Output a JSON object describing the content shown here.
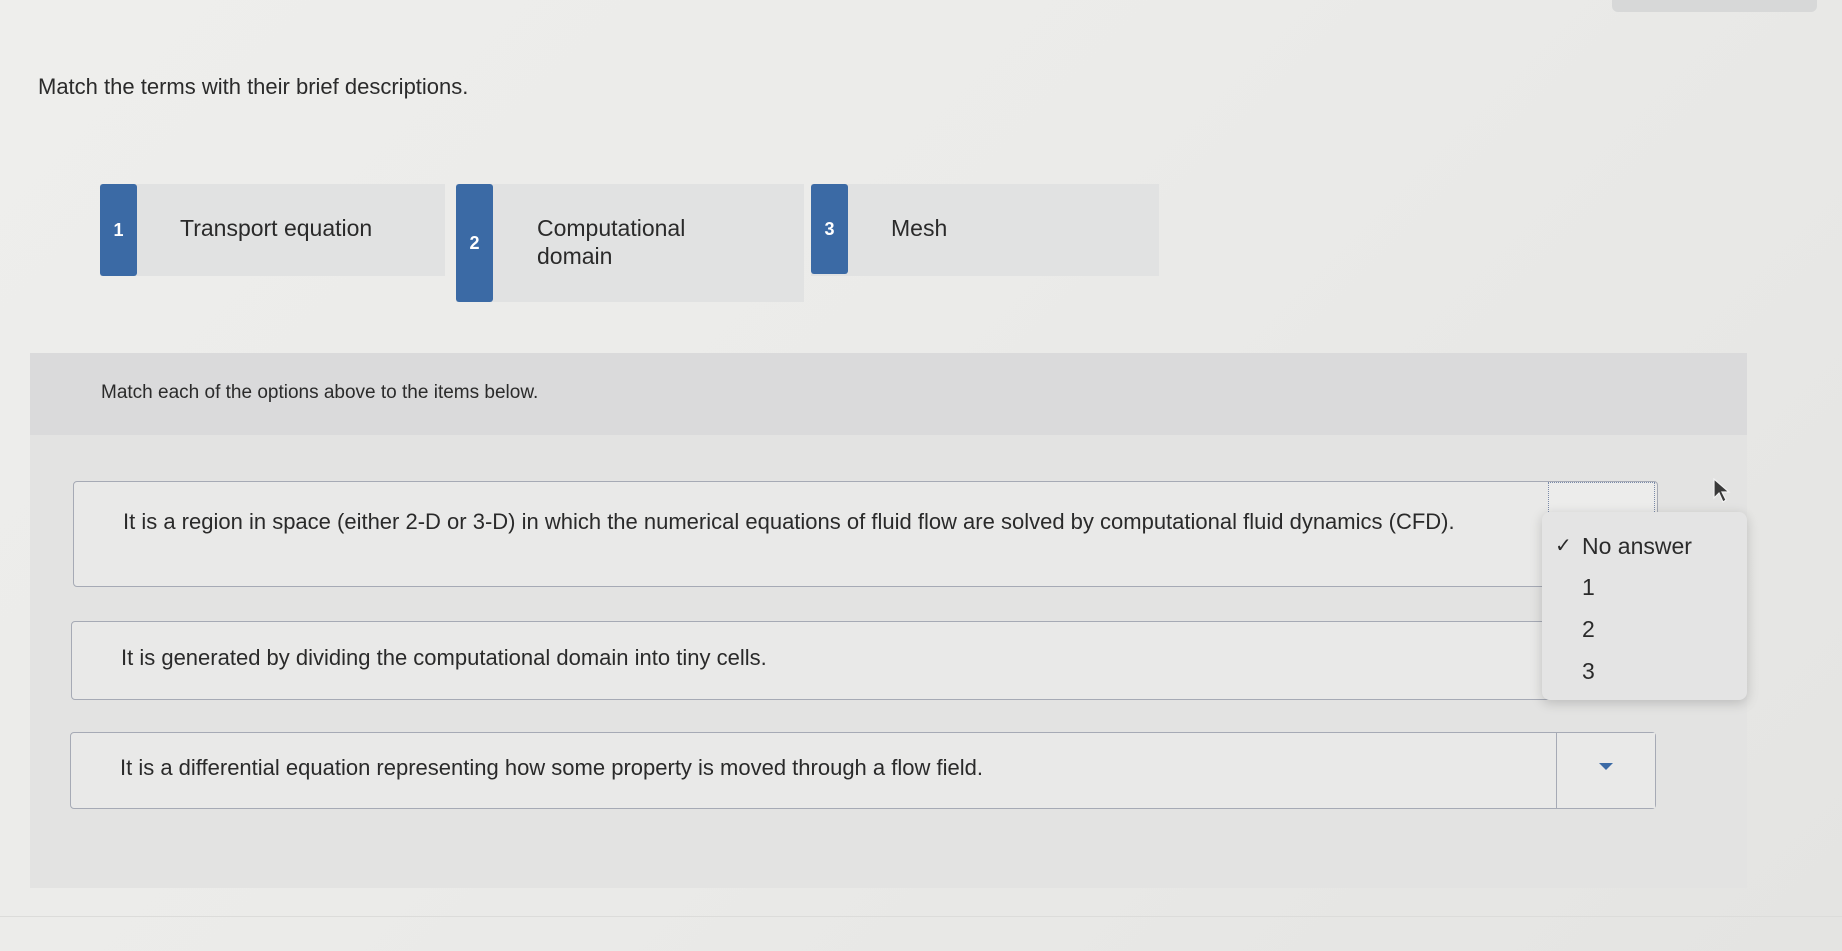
{
  "question": {
    "prompt": "Match the terms with their brief descriptions."
  },
  "terms": [
    {
      "number": "1",
      "label": "Transport equation"
    },
    {
      "number": "2",
      "label": "Computational domain"
    },
    {
      "number": "3",
      "label": "Mesh"
    }
  ],
  "matching": {
    "instruction": "Match each of the options above to the items below.",
    "items": [
      {
        "text": "It is a region in space (either 2-D or 3-D) in which the numerical equations of fluid flow are solved by computational fluid dynamics (CFD)."
      },
      {
        "text": "It is generated by dividing the computational domain into tiny cells."
      },
      {
        "text": "It is a differential equation representing how some property is moved through a flow field."
      }
    ]
  },
  "dropdown": {
    "options": [
      {
        "check": "✓",
        "label": "No answer"
      },
      {
        "check": "",
        "label": "1"
      },
      {
        "check": "",
        "label": "2"
      },
      {
        "check": "",
        "label": "3"
      }
    ]
  },
  "colors": {
    "badge": "#3b6aa5",
    "caret": "#3b6aa5",
    "background": "#ebebe9"
  },
  "icons": {
    "select_caret": "chevron-down-icon",
    "check": "checkmark-icon",
    "cursor": "mouse-pointer-icon"
  }
}
